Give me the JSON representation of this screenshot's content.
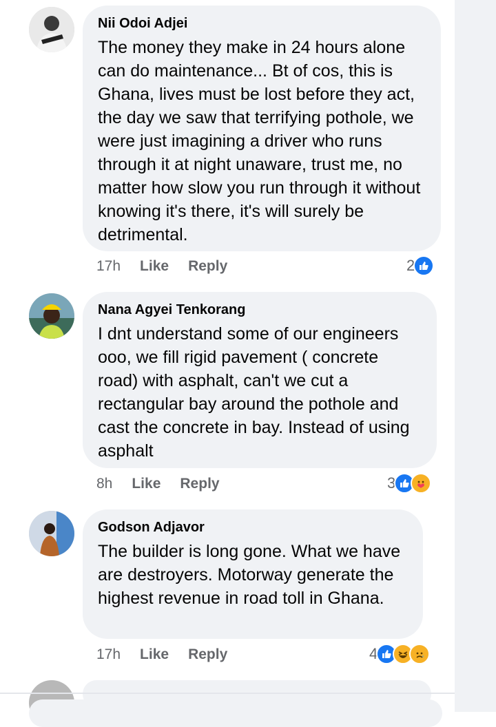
{
  "comments": [
    {
      "author": "Nii Odoi Adjei",
      "text": "The money they make in 24 hours alone can do maintenance... Bt of cos, this is Ghana, lives must be lost before they act, the day we saw that terrifying pothole, we were just imagining a driver who runs through it at night unaware, trust me, no matter how slow you run through it without knowing it's there, it's will surely be detrimental.",
      "time": "17h",
      "like_label": "Like",
      "reply_label": "Reply",
      "reaction_count": "2",
      "reactions": [
        "like"
      ]
    },
    {
      "author": "Nana Agyei Tenkorang",
      "text": "I dnt understand some of our engineers ooo, we fill rigid pavement ( concrete road) with asphalt, can't we cut a rectangular bay around the pothole and cast the concrete in bay. Instead of using asphalt",
      "time": "8h",
      "like_label": "Like",
      "reply_label": "Reply",
      "reaction_count": "3",
      "reactions": [
        "like",
        "care"
      ]
    },
    {
      "author": "Godson Adjavor",
      "text": "The builder is long gone. What we have are destroyers. Motorway generate the highest revenue in road toll in Ghana.",
      "time": "17h",
      "like_label": "Like",
      "reply_label": "Reply",
      "reaction_count": "4",
      "reactions": [
        "like",
        "haha",
        "sad"
      ]
    }
  ],
  "colors": {
    "bubble": "#f0f2f5",
    "meta_text": "#65676b",
    "like_blue": "#1877f2",
    "emoji_yellow": "#f7b125"
  }
}
